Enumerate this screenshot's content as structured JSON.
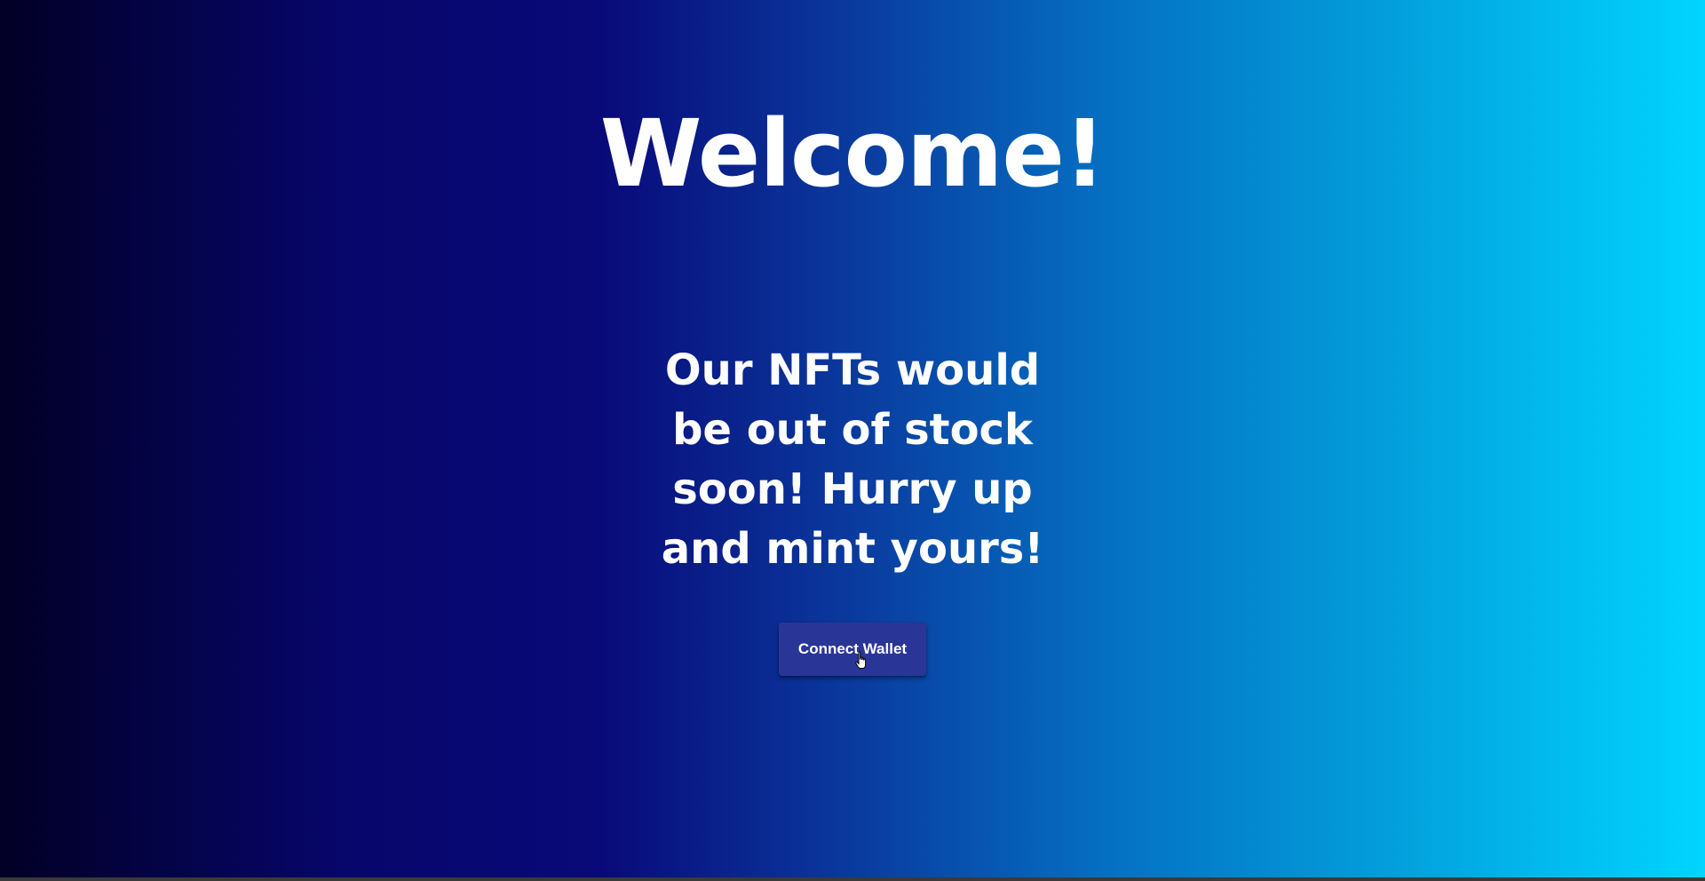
{
  "hero": {
    "title": "Welcome!",
    "tagline": "Our NFTs would be out of stock soon! Hurry up and mint yours!"
  },
  "actions": {
    "connect_wallet_label": "Connect Wallet"
  },
  "colors": {
    "gradient_start": "#020024",
    "gradient_mid": "#090979",
    "gradient_end": "#00d4ff",
    "button": "#2a3598"
  },
  "icons": {
    "pointer": "hand-pointer-icon"
  }
}
